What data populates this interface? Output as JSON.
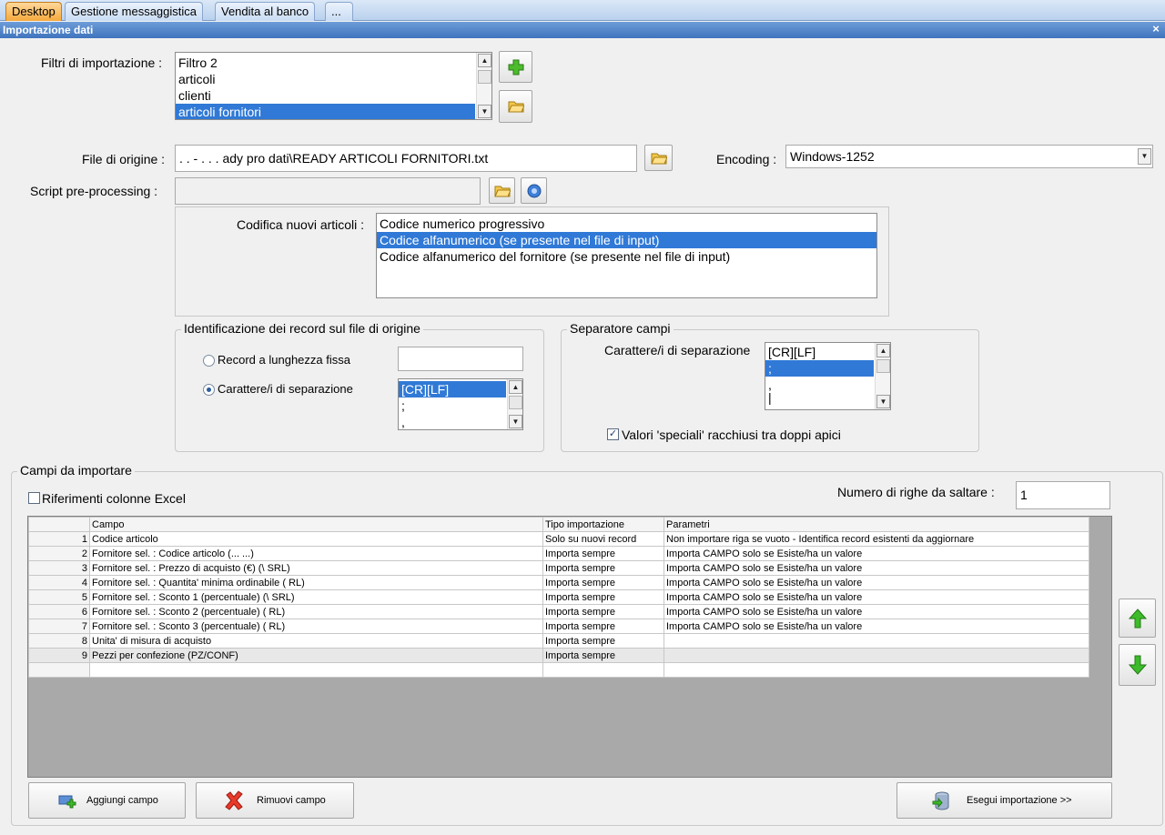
{
  "tabs": [
    {
      "label": "Desktop",
      "active": true
    },
    {
      "label": "Gestione messaggistica",
      "active": false
    },
    {
      "label": "Vendita al banco",
      "active": false
    },
    {
      "label": "...",
      "active": false
    }
  ],
  "window": {
    "title": "Importazione dati",
    "close_symbol": "×"
  },
  "filters": {
    "label": "Filtri di importazione :",
    "items": [
      "Filtro 2",
      "articoli",
      "clienti",
      "articoli fornitori"
    ],
    "selected_index": 3
  },
  "source_file": {
    "label": "File di origine :",
    "value": ". .     -  .         . . ady pro dati\\READY ARTICOLI FORNITORI.txt"
  },
  "encoding": {
    "label": "Encoding :",
    "value": "Windows-1252"
  },
  "script": {
    "label": "Script pre-processing :",
    "value": ""
  },
  "new_codes": {
    "label": "Codifica nuovi articoli :",
    "items": [
      "Codice numerico progressivo",
      "Codice alfanumerico (se presente nel file di input)",
      "Codice alfanumerico del fornitore (se presente nel file di input)"
    ],
    "selected_index": 1
  },
  "record_id": {
    "title": "Identificazione dei record sul file di origine",
    "opt_fixed": "Record a lunghezza fissa",
    "opt_separator": "Carattere/i di separazione",
    "selected": "separator",
    "fixed_value": "",
    "separators": [
      "[CR][LF]",
      ";",
      ","
    ]
  },
  "field_sep": {
    "title": "Separatore campi",
    "label": "Carattere/i di separazione",
    "items": [
      "[CR][LF]",
      ";",
      ",",
      "|"
    ],
    "selected_index": 1,
    "quote_label": "Valori 'speciali' racchiusi tra doppi apici",
    "quote_checked": true
  },
  "fields": {
    "title": "Campi da importare",
    "excel_label": "Riferimenti colonne Excel",
    "excel_checked": false,
    "skip_label": "Numero di righe da saltare  :",
    "skip_value": "1",
    "columns": [
      "Campo",
      "Tipo importazione",
      "Parametri"
    ],
    "rows": [
      {
        "n": "1",
        "campo": "Codice articolo",
        "tipo": "Solo su nuovi record",
        "param": "Non importare riga se vuoto - Identifica record esistenti da aggiornare"
      },
      {
        "n": "2",
        "campo": "Fornitore sel. : Codice articolo (...      ...)",
        "tipo": "Importa sempre",
        "param": "Importa CAMPO solo se Esiste/ha un valore"
      },
      {
        "n": "3",
        "campo": "Fornitore sel. : Prezzo di acquisto (€) (\\      SRL)",
        "tipo": "Importa sempre",
        "param": "Importa CAMPO solo se Esiste/ha un valore"
      },
      {
        "n": "4",
        "campo": "Fornitore sel. : Quantita' minima ordinabile (       RL)",
        "tipo": "Importa sempre",
        "param": "Importa CAMPO solo se Esiste/ha un valore"
      },
      {
        "n": "5",
        "campo": "Fornitore sel. : Sconto 1 (percentuale) (\\     SRL)",
        "tipo": "Importa sempre",
        "param": "Importa CAMPO solo se Esiste/ha un valore"
      },
      {
        "n": "6",
        "campo": "Fornitore sel. : Sconto 2 (percentuale) (       RL)",
        "tipo": "Importa sempre",
        "param": "Importa CAMPO solo se Esiste/ha un valore"
      },
      {
        "n": "7",
        "campo": "Fornitore sel. : Sconto 3 (percentuale) (       RL)",
        "tipo": "Importa sempre",
        "param": "Importa CAMPO solo se Esiste/ha un valore"
      },
      {
        "n": "8",
        "campo": "Unita' di misura di acquisto",
        "tipo": "Importa sempre",
        "param": ""
      },
      {
        "n": "9",
        "campo": "Pezzi per confezione (PZ/CONF)",
        "tipo": "Importa sempre",
        "param": ""
      }
    ]
  },
  "buttons": {
    "add_field": "Aggiungi campo",
    "remove_field": "Rimuovi campo",
    "run_import": "Esegui importazione >>"
  }
}
